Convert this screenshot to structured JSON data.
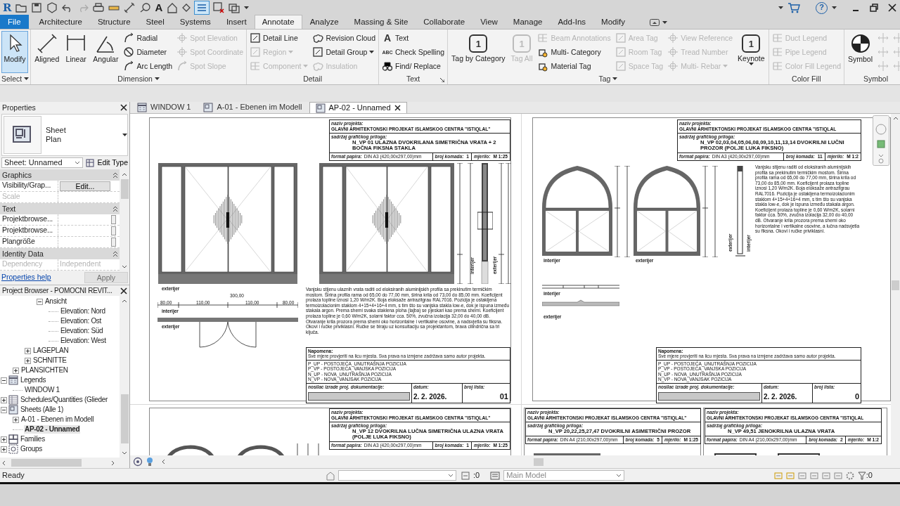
{
  "quick_access": {
    "logo": "R",
    "text_glyph": "A",
    "thin_lines_on": true,
    "help_glyph": "?"
  },
  "ribbon": {
    "tabs": [
      {
        "label": "File",
        "kind": "file",
        "selected": false
      },
      {
        "label": "Architecture",
        "kind": "tab",
        "selected": false
      },
      {
        "label": "Structure",
        "kind": "tab",
        "selected": false
      },
      {
        "label": "Steel",
        "kind": "tab",
        "selected": false
      },
      {
        "label": "Systems",
        "kind": "tab",
        "selected": false
      },
      {
        "label": "Insert",
        "kind": "tab",
        "selected": false
      },
      {
        "label": "Annotate",
        "kind": "tab",
        "selected": true
      },
      {
        "label": "Analyze",
        "kind": "tab",
        "selected": false
      },
      {
        "label": "Massing & Site",
        "kind": "tab",
        "selected": false
      },
      {
        "label": "Collaborate",
        "kind": "tab",
        "selected": false
      },
      {
        "label": "View",
        "kind": "tab",
        "selected": false
      },
      {
        "label": "Manage",
        "kind": "tab",
        "selected": false
      },
      {
        "label": "Add-Ins",
        "kind": "tab",
        "selected": false
      },
      {
        "label": "Modify",
        "kind": "tab",
        "selected": false
      }
    ],
    "panels": [
      {
        "title": "Select",
        "menu": true,
        "columns": [
          [
            {
              "label": "Modify",
              "kind": "large",
              "disabled": false,
              "active": true
            }
          ]
        ]
      },
      {
        "title": "Dimension",
        "menu": true,
        "columns": [
          [
            {
              "label": "Aligned",
              "kind": "large",
              "disabled": false
            }
          ],
          [
            {
              "label": "Linear",
              "kind": "large",
              "disabled": false
            }
          ],
          [
            {
              "label": "Angular",
              "kind": "large",
              "disabled": false
            }
          ],
          [
            {
              "label": "Radial",
              "kind": "small",
              "disabled": false
            },
            {
              "label": "Diameter",
              "kind": "small",
              "disabled": false
            },
            {
              "label": "Arc Length",
              "kind": "small",
              "disabled": false
            }
          ],
          [
            {
              "label": "Spot Elevation",
              "kind": "small",
              "disabled": true
            },
            {
              "label": "Spot Coordinate",
              "kind": "small",
              "disabled": true
            },
            {
              "label": "Spot Slope",
              "kind": "small",
              "disabled": true
            }
          ]
        ]
      },
      {
        "title": "Detail",
        "menu": false,
        "columns": [
          [
            {
              "label": "Detail Line",
              "kind": "small",
              "disabled": false
            },
            {
              "label": "Region",
              "kind": "small",
              "disabled": true,
              "dropdown": true
            },
            {
              "label": "Component",
              "kind": "small",
              "disabled": true,
              "dropdown": true
            }
          ],
          [
            {
              "label": "Revision Cloud",
              "kind": "small",
              "disabled": false
            },
            {
              "label": "Detail Group",
              "kind": "small",
              "disabled": false,
              "dropdown": true
            },
            {
              "label": "Insulation",
              "kind": "small",
              "disabled": true
            }
          ]
        ]
      },
      {
        "title": "Text",
        "menu": false,
        "launcher": true,
        "columns": [
          [
            {
              "label": "Text",
              "kind": "small",
              "disabled": false,
              "icon_text": "A"
            },
            {
              "label": "Check Spelling",
              "kind": "small",
              "disabled": false,
              "icon_text": "ABC"
            },
            {
              "label": "Find/ Replace",
              "kind": "small",
              "disabled": false
            }
          ]
        ]
      },
      {
        "title": "Tag",
        "menu": true,
        "columns": [
          [
            {
              "label": "Tag by Category",
              "kind": "large",
              "disabled": false,
              "icon_text": "1"
            }
          ],
          [
            {
              "label": "Tag All",
              "kind": "large",
              "disabled": true,
              "icon_text": "1"
            }
          ],
          [
            {
              "label": "Beam Annotations",
              "kind": "small",
              "disabled": true
            },
            {
              "label": "Multi- Category",
              "kind": "small",
              "disabled": false
            },
            {
              "label": "Material Tag",
              "kind": "small",
              "disabled": false
            }
          ],
          [
            {
              "label": "Area Tag",
              "kind": "small",
              "disabled": true
            },
            {
              "label": "Room Tag",
              "kind": "small",
              "disabled": true
            },
            {
              "label": "Space Tag",
              "kind": "small",
              "disabled": true
            }
          ],
          [
            {
              "label": "View Reference",
              "kind": "small",
              "disabled": true
            },
            {
              "label": "Tread Number",
              "kind": "small",
              "disabled": true
            },
            {
              "label": "Multi- Rebar",
              "kind": "small",
              "disabled": true,
              "dropdown": true
            }
          ],
          [
            {
              "label": "Keynote",
              "kind": "large",
              "disabled": false,
              "icon_text": "1",
              "dropdown": true
            }
          ]
        ]
      },
      {
        "title": "Color Fill",
        "menu": false,
        "columns": [
          [
            {
              "label": "Duct Legend",
              "kind": "small",
              "disabled": true
            },
            {
              "label": "Pipe Legend",
              "kind": "small",
              "disabled": true
            },
            {
              "label": "Color Fill Legend",
              "kind": "small",
              "disabled": true
            }
          ]
        ]
      },
      {
        "title": "Symbol",
        "menu": false,
        "columns": [
          [
            {
              "label": "Symbol",
              "kind": "large",
              "disabled": false
            }
          ],
          [
            {
              "kind": "icon",
              "disabled": true
            },
            {
              "kind": "icon",
              "disabled": true
            },
            {
              "kind": "icon",
              "disabled": true
            }
          ],
          [
            {
              "kind": "icon",
              "disabled": true
            },
            {
              "kind": "icon",
              "disabled": true
            },
            {
              "kind": "icon",
              "disabled": true
            }
          ]
        ]
      }
    ]
  },
  "properties": {
    "title": "Properties",
    "type_lines": [
      "Sheet",
      "Plan"
    ],
    "selector": "Sheet: Unnamed",
    "edit_type": "Edit Type",
    "groups": [
      {
        "title": "Graphics",
        "rows": [
          {
            "name": "Visibility/Grap...",
            "value": "Edit...",
            "kind": "button",
            "disabled": false
          },
          {
            "name": "Scale",
            "kind": "text",
            "disabled": true
          }
        ]
      },
      {
        "title": "Text",
        "rows": [
          {
            "name": "Projektbrowse...",
            "kind": "field",
            "disabled": false
          },
          {
            "name": "Projektbrowse...",
            "kind": "field",
            "disabled": false
          },
          {
            "name": "Plangröße",
            "kind": "field",
            "disabled": false
          }
        ]
      },
      {
        "title": "Identity Data",
        "rows": [
          {
            "name": "Dependency",
            "value": "Independent",
            "kind": "text",
            "disabled": true
          }
        ]
      }
    ],
    "help": "Properties help",
    "apply": {
      "label": "Apply",
      "disabled": true
    }
  },
  "project_browser": {
    "title": "Project Browser - POMOCNI REVIT...",
    "tree": [
      {
        "children": [
          {
            "children": [
              {
                "children": [
                  {
                    "label": "Ansicht",
                    "expanded": true,
                    "selected": false,
                    "children": [
                      {
                        "label": "Elevation: Nord",
                        "selected": false
                      },
                      {
                        "label": "Elevation: Ost",
                        "selected": false
                      },
                      {
                        "label": "Elevation: Süd",
                        "selected": false
                      },
                      {
                        "label": "Elevation: West",
                        "selected": false
                      }
                    ]
                  }
                ]
              },
              {
                "label": "LAGEPLAN",
                "expanded": false,
                "selected": false
              },
              {
                "label": "SCHNITTE",
                "expanded": false,
                "selected": false
              }
            ]
          },
          {
            "label": "PLANSICHTEN",
            "expanded": false,
            "selected": false
          }
        ]
      },
      {
        "label": "Legends",
        "expanded": true,
        "selected": false,
        "children": [
          {
            "label": "WINDOW 1",
            "selected": false
          }
        ]
      },
      {
        "label": "Schedules/Quantities (Glieder",
        "expanded": false,
        "selected": false
      },
      {
        "label": "Sheets (Alle 1)",
        "expanded": true,
        "selected": false,
        "children": [
          {
            "label": "A-01 - Ebenen im Modell",
            "expanded": false,
            "selected": false
          },
          {
            "label": "AP-02 - Unnamed",
            "selected": true
          }
        ]
      },
      {
        "label": "Families",
        "expanded": false,
        "selected": false
      },
      {
        "label": "Groups",
        "expanded": false,
        "selected": false
      }
    ]
  },
  "view_tabs": [
    {
      "label": "WINDOW 1",
      "kind": "legend",
      "selected": false
    },
    {
      "label": "A-01 - Ebenen im Modell",
      "kind": "sheet",
      "selected": false
    },
    {
      "label": "AP-02 - Unnamed",
      "kind": "sheet",
      "selected": true
    }
  ],
  "sheets": [
    {
      "project_label": "naziv projekta:",
      "project": "GLAVNI ARHITEKTONSKI PROJEKAT ISLAMSKOG CENTRA \"ISTIQLAL\"",
      "content_label": "sadržaj grafičkog priloga:",
      "content": "N_VP 01 ULAZNA DVOKRILANA SIMETRIČNA VRATA + 2 BOČNA FIKSNA STAKLA",
      "format_label": "format papira:",
      "format": "DIN A3 (420,00x297,00)mm",
      "count_label": "broj komada:",
      "count": "1",
      "scale_label": "mjerilo:",
      "scale": "M 1:25",
      "labels": [
        "exterijer",
        "interijer",
        "exterijer",
        "interijer",
        "exterijer"
      ],
      "plan_dimensions": [
        "300,00",
        "80,00",
        "110,00",
        "110,00",
        "80,00"
      ],
      "description": "Vanjsku stijenu ulaznih vrata raditi od eloksiranih aluminijskih profila sa prekinutim termičkim mostom. Širina profila rama od 65,00 do 77,00 mm, širina krila od 73,00 do 85,00 mm. Koeficijent prolaza topline iznosi 1,20 W/m2K. Boja eloksaže antrazitgrau RAL7016. Pozicija je ostakljena termoizolacionim staklom 4+15+4+16+4 mm, s tim što su vanjska stakla low-e, dok je ispuna između stakala argon. Prema shemi svaka staklena ploha (lajba) se pjeskari kao prema shemi. Koeficijent prolaza topline je 0,60 W/m2K, solarni faktor cca. 50%, zvučna izolacija 32,00 do 40,00 dB. Otvaranje krila prozora prema shemi oko horizontalne i vertikalne osovine, a nadsvjetla su fiksna. Okovi i ručke priviklasni. Ručke se biraju uz konsultaciju sa projektantom, brava cilindrična sa tri ključa.",
      "footer": {
        "note_title": "Napomena:",
        "note": "Sve mjere provjeriti na licu mjesta. Sva prava na izmjene zadržava samo autor projekta.",
        "legend": [
          "P_UP - POSTOJEĆA_UNUTRAŠNJA POZICIJA",
          "P_VP - POSTOJEĆA_VANJSKA POZICIJA",
          "N_UP - NOVA_UNUTRAŠNJA POZICIJA",
          "N_VP - NOVA_VANJSAK POZICIJA"
        ],
        "maker_label": "nosilac izrade proj. dokumentacije:",
        "date_label": "datum:",
        "date": "2. 2. 2026.",
        "sheet_no_label": "broj lista:",
        "sheet_no": "01"
      }
    },
    {
      "project_label": "naziv projekta:",
      "project": "GLAVNI ARHITEKTONSKI PROJEKAT ISLAMSKOG CENTRA \"ISTIQLAL",
      "content_label": "sadržaj grafičkog priloga:",
      "content": "N_VP 02,03,04,05,06,08,09,10,11,13,14 DVOKRILNI LUČNI PROZOR (POLJE LUKA FIKSNO)",
      "format_label": "format papira:",
      "format": "DIN A3 (420,00x297,00)mm",
      "count_label": "broj komada:",
      "count": "11",
      "scale_label": "mjerilo:",
      "scale": "M 1:2",
      "labels": [
        "interijer",
        "exterijer",
        "exterijer",
        "interijer",
        "interijer",
        "exterijer"
      ],
      "description": "Vanjsku stijenu raditi od eloksiranih aluminijskih profila sa prekinutim termičkim mostom. Širina profila rama od 65,00 do 77,00 mm, širina krila od 73,00 do 85,00 mm. Koeficijent prolaza topline iznosi 1,20 W/m2K. Boja eloksaže antrazitgrau RAL7016. Pozicija je ostakljena termoizolacionim staklom 4+15+4+16+4 mm, s tim što su vanjska stakla low-e, dok je ispuna između stakala argon. Koeficijent prolaza topline je 0,60 W/m2K, solarni faktor cca. 50%, zvučna izolacija 32,00 do 40,00 dB. Otvaranje krila prozora prema shemi oko horizontalne i vertikalne osovine, a lučna nadsvjetla su fiksna. Okovi i ručke priviklasni.",
      "footer": {
        "note_title": "Napomena:",
        "note": "Sve mjere provjeriti na licu mjesta. Sva prava na izmjene zadržava samo autor projekta.",
        "legend": [
          "P_UP - POSTOJEĆA_UNUTRAŠNJA POZICIJA",
          "P_VP - POSTOJEĆA_VANJSKA POZICIJA",
          "N_UP - NOVA_UNUTRAŠNJA POZICIJA",
          "N_VP - NOVA_VANJSAK POZICIJA"
        ],
        "maker_label": "nosilac izrade proj. dokumentacije:",
        "date_label": "datum:",
        "date": "2. 2. 2026.",
        "sheet_no_label": "broj lista:",
        "sheet_no": "0"
      }
    },
    {
      "project_label": "naziv projekta:",
      "project": "GLAVNI ARHITEKTONSKI PROJEKAT ISLAMSKOG CENTRA \"ISTIQLAL\"",
      "content_label": "sadržaj grafičkog priloga:",
      "content": "N_VP 12 DVOKRILNA LUČNA SIMETRIČNA ULAZNA VRATA (POLJE LUKA FIKSNO)",
      "format_label": "format papira:",
      "format": "DIN A3 (420,00x297,00)mm",
      "count_label": "broj komada:",
      "count": "1",
      "scale_label": "mjerilo:",
      "scale": "M 1:25"
    },
    {
      "project_label": "naziv projekta:",
      "project": "GLAVNI ARHITEKTONSKI PROJEKAT ISLAMSKOG CENTRA \"ISTIQLAL\"",
      "content_label": "sadržaj grafičkog priloga:",
      "content": "N_VP 20,22,25,27,47 DVOKRILNI ASIMETRIČNI PROZOR",
      "format_label": "format papira:",
      "format": "DIN A4 (210,00x297,00)mm",
      "count_label": "broj komada:",
      "count": "5",
      "scale_label": "mjerilo:",
      "scale": "M 1:25"
    },
    {
      "project_label": "naziv projekta:",
      "project": "GLAVNI ARHITEKTONSKI PROJEKAT ISLAMSKOG CENTRA \"ISTIQLAL",
      "content_label": "sadržaj grafičkog priloga:",
      "content": "N_VP 49,51 JENOKRILNA ULAZNA VRATA",
      "format_label": "format papira:",
      "format": "DIN A4 (210,00x297,00)mm",
      "count_label": "broj komada:",
      "count": "2",
      "scale_label": "mjerilo:",
      "scale": "M 1:2"
    }
  ],
  "status_bar": {
    "message": "Ready",
    "workset_count": ":0",
    "design_option": "Main Model",
    "filter_count": ":0"
  }
}
